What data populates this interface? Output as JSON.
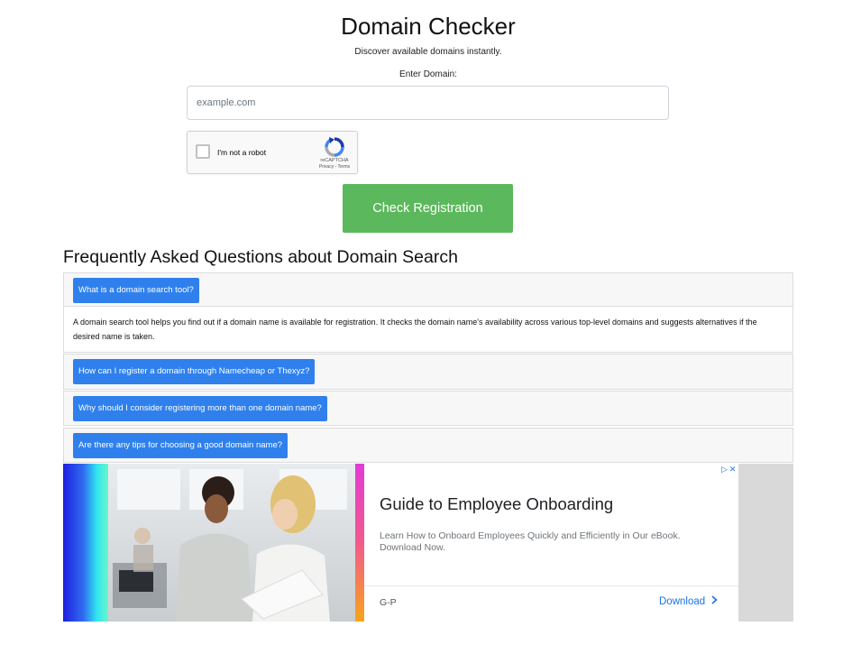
{
  "header": {
    "title": "Domain Checker",
    "subtitle": "Discover available domains instantly."
  },
  "form": {
    "label": "Enter Domain:",
    "placeholder": "example.com",
    "value": "",
    "submit_label": "Check Registration"
  },
  "recaptcha": {
    "label": "I'm not a robot",
    "brand": "reCAPTCHA",
    "links": "Privacy - Terms",
    "checked": false
  },
  "faq": {
    "heading": "Frequently Asked Questions about Domain Search",
    "items": [
      {
        "question": "What is a domain search tool?",
        "answer": "A domain search tool helps you find out if a domain name is available for registration. It checks the domain name's availability across various top-level domains and suggests alternatives if the desired name is taken.",
        "expanded": true
      },
      {
        "question": "How can I register a domain through Namecheap or Thexyz?",
        "expanded": false
      },
      {
        "question": "Why should I consider registering more than one domain name?",
        "expanded": false
      },
      {
        "question": "Are there any tips for choosing a good domain name?",
        "expanded": false
      }
    ]
  },
  "ad": {
    "title": "Guide to Employee Onboarding",
    "description": "Learn How to Onboard Employees Quickly and Efficiently in Our eBook. Download Now.",
    "advertiser": "G-P",
    "cta": "Download",
    "choices_icons": "▷✕"
  },
  "colors": {
    "primary_button": "#5cb85c",
    "faq_button": "#2f80ed",
    "link": "#1a73e8"
  }
}
